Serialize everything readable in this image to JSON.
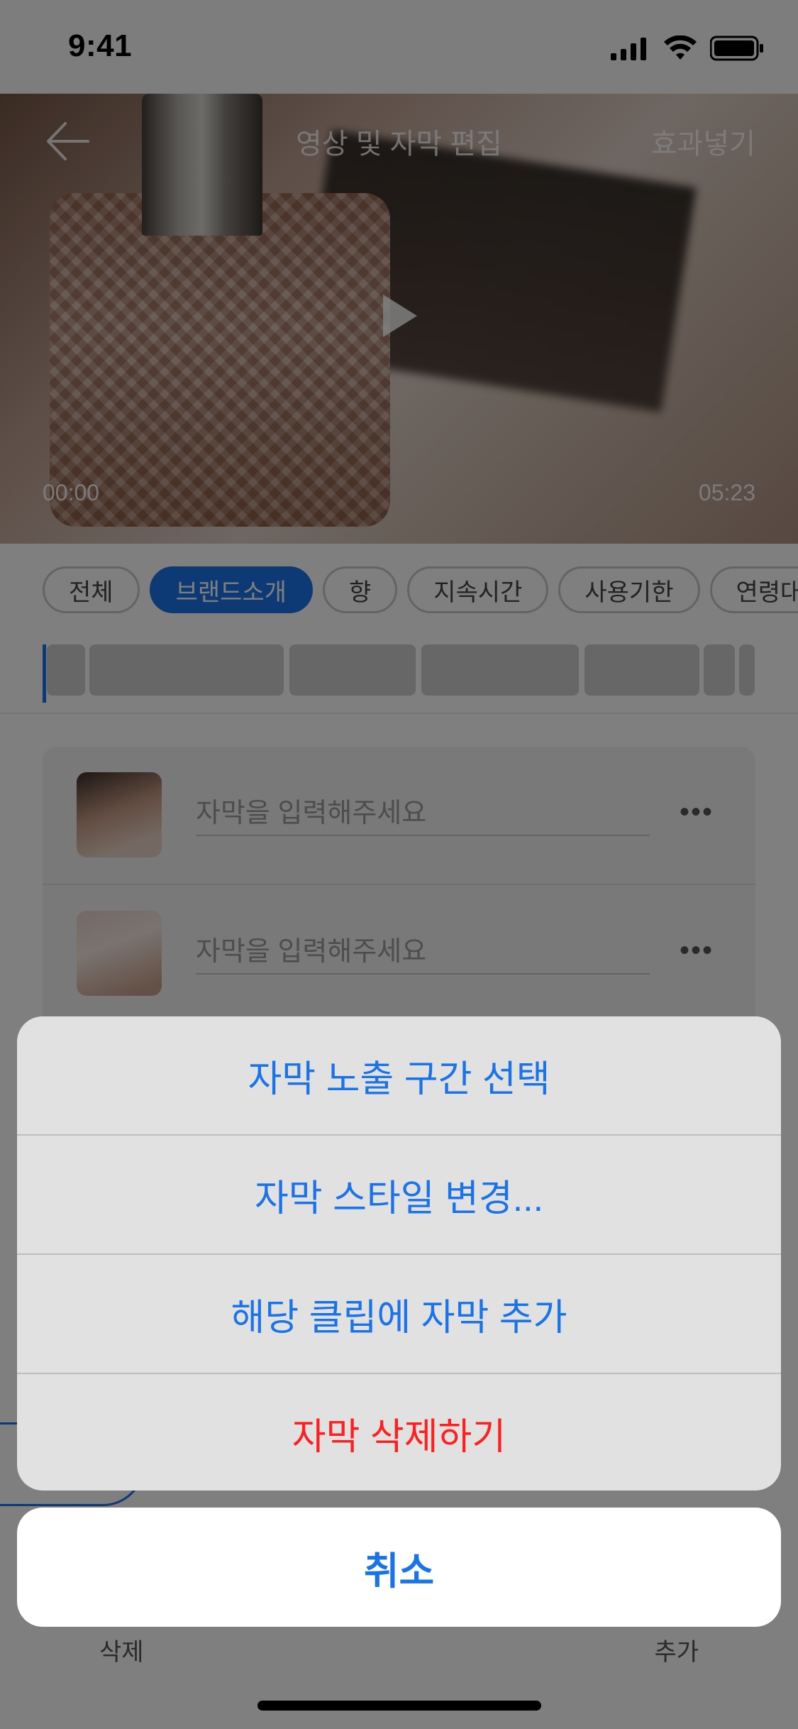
{
  "status_bar": {
    "time": "9:41"
  },
  "header": {
    "title": "영상 및 자막 편집",
    "effect_button": "효과넣기",
    "back_icon": "arrow-left-icon"
  },
  "video": {
    "time_start": "00:00",
    "time_end": "05:23",
    "play_icon": "play-icon"
  },
  "tabs": [
    {
      "label": "전체"
    },
    {
      "label": "브랜드소개",
      "active": true
    },
    {
      "label": "향"
    },
    {
      "label": "지속시간"
    },
    {
      "label": "사용기한"
    },
    {
      "label": "연령대"
    }
  ],
  "subtitle_list": {
    "items": [
      {
        "placeholder": "자막을 입력해주세요"
      },
      {
        "placeholder": "자막을 입력해주세요"
      }
    ]
  },
  "bottom_bar": {
    "delete_label": "삭제",
    "add_label": "추가"
  },
  "action_sheet": {
    "options": [
      {
        "label": "자막 노출 구간 선택"
      },
      {
        "label": "자막 스타일 변경..."
      },
      {
        "label": "해당 클립에 자막 추가"
      },
      {
        "label": "자막 삭제하기",
        "destructive": true
      }
    ],
    "cancel_label": "취소"
  },
  "colors": {
    "accent": "#1a73e8",
    "destructive": "#ff1f1f"
  }
}
